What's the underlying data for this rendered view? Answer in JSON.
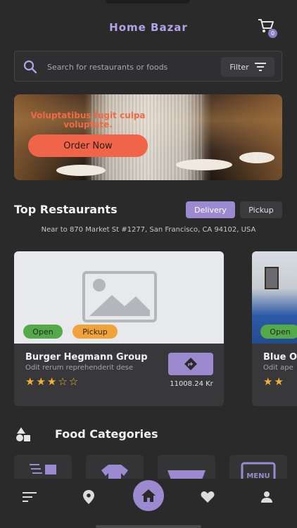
{
  "app": {
    "title": "Home Bazar",
    "cart_count": "0"
  },
  "search": {
    "placeholder": "Search for restaurants or foods",
    "filter_label": "Filter"
  },
  "banner": {
    "headline": "Voluptatibus fugit culpa voluptate.",
    "button_label": "Order Now"
  },
  "restaurants": {
    "title": "Top Restaurants",
    "tabs": [
      {
        "label": "Delivery",
        "active": true
      },
      {
        "label": "Pickup",
        "active": false
      }
    ],
    "address": "Near to 870 Market St #1277, San Francisco, CA 94102, USA",
    "cards": [
      {
        "name": "Burger Hegmann Group",
        "description": "Odit rerum reprehenderit dese",
        "rating": 3,
        "rating_stars": "★★★☆☆",
        "distance": "11008.24 Kr",
        "badges": [
          "Open",
          "Pickup"
        ]
      },
      {
        "name": "Blue O",
        "description": "Odit ape",
        "rating_stars": "★★",
        "badges": [
          "Open"
        ]
      }
    ]
  },
  "categories": {
    "title": "Food Categories",
    "menu_label": "MENU"
  },
  "colors": {
    "accent": "#9b8ad0",
    "background": "#2a2a2b",
    "card": "#38383a",
    "open_badge": "#54a94a",
    "pickup_badge": "#f0a33a",
    "banner_button": "#f0654a",
    "stars": "#f3b233"
  },
  "nav": {
    "items": [
      "menu-icon",
      "location-icon",
      "home-icon",
      "heart-icon",
      "user-icon"
    ]
  }
}
